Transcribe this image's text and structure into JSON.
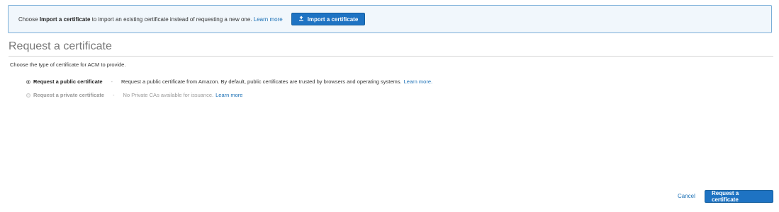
{
  "banner": {
    "text_prefix": "Choose",
    "text_bold": "Import a certificate",
    "text_suffix": "to import an existing certificate instead of requesting a new one.",
    "learn_more": "Learn more",
    "import_button_label": "Import a certificate",
    "import_icon": "upload-icon"
  },
  "page": {
    "title": "Request a certificate",
    "description": "Choose the type of certificate for ACM to provide."
  },
  "options": [
    {
      "label": "Request a public certificate",
      "selected": true,
      "enabled": true,
      "separator": "-",
      "description": "Request a public certificate from Amazon. By default, public certificates are trusted by browsers and operating systems.",
      "link": "Learn more."
    },
    {
      "label": "Request a private certificate",
      "selected": false,
      "enabled": false,
      "separator": "-",
      "description": "No Private CAs available for issuance.",
      "link": "Learn more"
    }
  ],
  "footer": {
    "cancel_label": "Cancel",
    "submit_label": "Request a certificate"
  },
  "colors": {
    "primary": "#1e73c3",
    "link": "#1a6fb5",
    "banner_bg": "#f1f7fc",
    "banner_border": "#7aaed8"
  }
}
